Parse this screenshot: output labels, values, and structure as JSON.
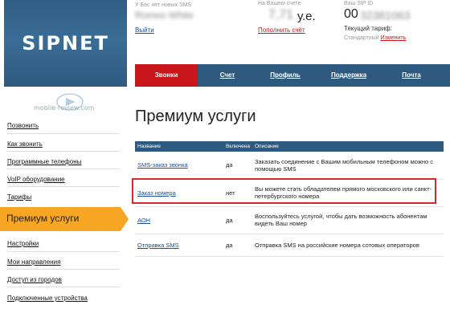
{
  "logo": "SIPNET",
  "account": {
    "sms_caption": "У Вас нет новых SMS",
    "user_name": "Romeo White",
    "logout": "Выйти"
  },
  "balance": {
    "caption": "На Вашем счете",
    "amount": "7,71",
    "currency": "у.е.",
    "topup": "Пополнить счёт"
  },
  "sip": {
    "caption": "Ваш SIP ID",
    "id_prefix": "00",
    "id_rest": "32381063",
    "tariff_label": "Текущий тариф:",
    "tariff_name": "Стандартный",
    "change": "Изменить"
  },
  "nav": [
    "Звонки",
    "Счет",
    "Профиль",
    "Поддержка",
    "Почта"
  ],
  "sidebar": {
    "items_top": [
      "Позвонить",
      "Как звонить",
      "Программные телефоны",
      "VoIP оборудование",
      "Тарифы"
    ],
    "active": "Премиум услуги",
    "items_bottom": [
      "Настройки",
      "Мои направления",
      "Доступ из городов",
      "Подключенные устройства"
    ]
  },
  "watermark": "mobile-review.com",
  "page_title": "Премиум услуги",
  "table": {
    "headers": [
      "Название",
      "Включена",
      "Описание"
    ],
    "rows": [
      {
        "name": "SMS-заказ звонка",
        "enabled": "да",
        "desc": "Заказать соединение с Вашим мобильным телефоном можно с помощью SMS"
      },
      {
        "name": "Заказ номера",
        "enabled": "нет",
        "desc": "Вы можете стать обладателем прямого московского или санкт-петербургского номера"
      },
      {
        "name": "АОН",
        "enabled": "да",
        "desc": "Воспользуйтесь услугой, чтобы дать возможность абонентам видеть Ваш номер"
      },
      {
        "name": "Отправка SMS",
        "enabled": "да",
        "desc": "Отправка SMS на российские номера сотовых операторов"
      }
    ]
  },
  "colors": {
    "brand_blue": "#2e5a80",
    "accent_red": "#c8161a",
    "active_orange": "#f6a623"
  }
}
